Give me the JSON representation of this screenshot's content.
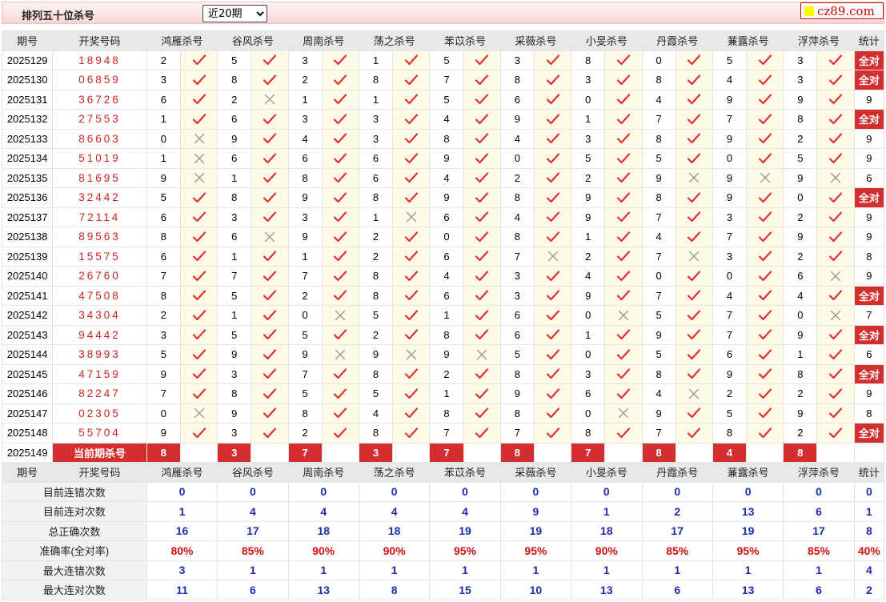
{
  "header": {
    "title": "排列五十位杀号",
    "period_select": {
      "selected": "近20期",
      "options": [
        "近20期"
      ]
    },
    "logo_text": "cz89.com"
  },
  "columns": {
    "issue": "期号",
    "draw": "开奖号码",
    "experts": [
      "鸿雁杀号",
      "谷风杀号",
      "周南杀号",
      "荡之杀号",
      "苯苡杀号",
      "采薇杀号",
      "小旻杀号",
      "丹霞杀号",
      "蒹露杀号",
      "浮萍杀号"
    ],
    "stat": "统计"
  },
  "rows": [
    {
      "issue": "2025129",
      "draw": "18948",
      "kills": [
        "2",
        "5",
        "3",
        "1",
        "5",
        "3",
        "8",
        "0",
        "5",
        "3"
      ],
      "marks": [
        "r",
        "r",
        "r",
        "r",
        "r",
        "r",
        "r",
        "r",
        "r",
        "r"
      ],
      "stat": "全对"
    },
    {
      "issue": "2025130",
      "draw": "06859",
      "kills": [
        "3",
        "8",
        "2",
        "8",
        "7",
        "8",
        "3",
        "8",
        "4",
        "3"
      ],
      "marks": [
        "r",
        "r",
        "r",
        "r",
        "r",
        "r",
        "r",
        "r",
        "r",
        "r"
      ],
      "stat": "全对"
    },
    {
      "issue": "2025131",
      "draw": "36726",
      "kills": [
        "6",
        "2",
        "1",
        "1",
        "5",
        "6",
        "0",
        "4",
        "9",
        "9"
      ],
      "marks": [
        "r",
        "w",
        "r",
        "r",
        "r",
        "r",
        "r",
        "r",
        "r",
        "r"
      ],
      "stat": "9"
    },
    {
      "issue": "2025132",
      "draw": "27553",
      "kills": [
        "1",
        "6",
        "3",
        "3",
        "4",
        "9",
        "1",
        "7",
        "7",
        "8"
      ],
      "marks": [
        "r",
        "r",
        "r",
        "r",
        "r",
        "r",
        "r",
        "r",
        "r",
        "r"
      ],
      "stat": "全对"
    },
    {
      "issue": "2025133",
      "draw": "86603",
      "kills": [
        "0",
        "9",
        "4",
        "3",
        "8",
        "4",
        "3",
        "8",
        "9",
        "2"
      ],
      "marks": [
        "w",
        "r",
        "r",
        "r",
        "r",
        "r",
        "r",
        "r",
        "r",
        "r"
      ],
      "stat": "9"
    },
    {
      "issue": "2025134",
      "draw": "51019",
      "kills": [
        "1",
        "6",
        "6",
        "6",
        "9",
        "0",
        "5",
        "5",
        "0",
        "5"
      ],
      "marks": [
        "w",
        "r",
        "r",
        "r",
        "r",
        "r",
        "r",
        "r",
        "r",
        "r"
      ],
      "stat": "9"
    },
    {
      "issue": "2025135",
      "draw": "81695",
      "kills": [
        "9",
        "1",
        "8",
        "6",
        "4",
        "2",
        "2",
        "9",
        "9",
        "9"
      ],
      "marks": [
        "w",
        "r",
        "r",
        "r",
        "r",
        "r",
        "r",
        "w",
        "w",
        "w"
      ],
      "stat": "6"
    },
    {
      "issue": "2025136",
      "draw": "32442",
      "kills": [
        "5",
        "8",
        "9",
        "8",
        "9",
        "8",
        "9",
        "8",
        "9",
        "0"
      ],
      "marks": [
        "r",
        "r",
        "r",
        "r",
        "r",
        "r",
        "r",
        "r",
        "r",
        "r"
      ],
      "stat": "全对"
    },
    {
      "issue": "2025137",
      "draw": "72114",
      "kills": [
        "6",
        "3",
        "3",
        "1",
        "6",
        "4",
        "9",
        "7",
        "3",
        "2"
      ],
      "marks": [
        "r",
        "r",
        "r",
        "w",
        "r",
        "r",
        "r",
        "r",
        "r",
        "r"
      ],
      "stat": "9"
    },
    {
      "issue": "2025138",
      "draw": "89563",
      "kills": [
        "8",
        "6",
        "9",
        "2",
        "0",
        "8",
        "1",
        "4",
        "7",
        "9"
      ],
      "marks": [
        "r",
        "w",
        "r",
        "r",
        "r",
        "r",
        "r",
        "r",
        "r",
        "r"
      ],
      "stat": "9"
    },
    {
      "issue": "2025139",
      "draw": "15575",
      "kills": [
        "6",
        "1",
        "1",
        "2",
        "6",
        "7",
        "2",
        "7",
        "3",
        "2"
      ],
      "marks": [
        "r",
        "r",
        "r",
        "r",
        "r",
        "w",
        "r",
        "w",
        "r",
        "r"
      ],
      "stat": "8"
    },
    {
      "issue": "2025140",
      "draw": "26760",
      "kills": [
        "7",
        "7",
        "7",
        "8",
        "4",
        "3",
        "4",
        "0",
        "0",
        "6"
      ],
      "marks": [
        "r",
        "r",
        "r",
        "r",
        "r",
        "r",
        "r",
        "r",
        "r",
        "w"
      ],
      "stat": "9"
    },
    {
      "issue": "2025141",
      "draw": "47508",
      "kills": [
        "8",
        "5",
        "2",
        "8",
        "6",
        "3",
        "9",
        "7",
        "4",
        "4"
      ],
      "marks": [
        "r",
        "r",
        "r",
        "r",
        "r",
        "r",
        "r",
        "r",
        "r",
        "r"
      ],
      "stat": "全对"
    },
    {
      "issue": "2025142",
      "draw": "34304",
      "kills": [
        "2",
        "1",
        "0",
        "5",
        "1",
        "6",
        "0",
        "5",
        "7",
        "0"
      ],
      "marks": [
        "r",
        "r",
        "w",
        "r",
        "r",
        "r",
        "w",
        "r",
        "r",
        "w"
      ],
      "stat": "7"
    },
    {
      "issue": "2025143",
      "draw": "94442",
      "kills": [
        "3",
        "5",
        "5",
        "2",
        "8",
        "6",
        "1",
        "9",
        "7",
        "9"
      ],
      "marks": [
        "r",
        "r",
        "r",
        "r",
        "r",
        "r",
        "r",
        "r",
        "r",
        "r"
      ],
      "stat": "全对"
    },
    {
      "issue": "2025144",
      "draw": "38993",
      "kills": [
        "5",
        "9",
        "9",
        "9",
        "9",
        "5",
        "0",
        "5",
        "6",
        "1"
      ],
      "marks": [
        "r",
        "r",
        "w",
        "w",
        "w",
        "r",
        "r",
        "r",
        "r",
        "r"
      ],
      "stat": "6"
    },
    {
      "issue": "2025145",
      "draw": "47159",
      "kills": [
        "9",
        "3",
        "7",
        "8",
        "2",
        "8",
        "3",
        "8",
        "9",
        "8"
      ],
      "marks": [
        "r",
        "r",
        "r",
        "r",
        "r",
        "r",
        "r",
        "r",
        "r",
        "r"
      ],
      "stat": "全对"
    },
    {
      "issue": "2025146",
      "draw": "82247",
      "kills": [
        "7",
        "8",
        "5",
        "5",
        "1",
        "9",
        "6",
        "4",
        "2",
        "2"
      ],
      "marks": [
        "r",
        "r",
        "r",
        "r",
        "r",
        "r",
        "r",
        "w",
        "r",
        "r"
      ],
      "stat": "9"
    },
    {
      "issue": "2025147",
      "draw": "02305",
      "kills": [
        "0",
        "9",
        "8",
        "4",
        "8",
        "8",
        "0",
        "9",
        "5",
        "9"
      ],
      "marks": [
        "w",
        "r",
        "r",
        "r",
        "r",
        "r",
        "w",
        "r",
        "r",
        "r"
      ],
      "stat": "8"
    },
    {
      "issue": "2025148",
      "draw": "55704",
      "kills": [
        "9",
        "3",
        "2",
        "8",
        "7",
        "7",
        "8",
        "7",
        "8",
        "2"
      ],
      "marks": [
        "r",
        "r",
        "r",
        "r",
        "r",
        "r",
        "r",
        "r",
        "r",
        "r"
      ],
      "stat": "全对"
    }
  ],
  "current": {
    "issue": "2025149",
    "label": "当前期杀号",
    "kills": [
      "8",
      "3",
      "7",
      "3",
      "7",
      "8",
      "7",
      "8",
      "4",
      "8"
    ]
  },
  "summary": [
    {
      "label": "目前连错次数",
      "values": [
        "0",
        "0",
        "0",
        "0",
        "0",
        "0",
        "0",
        "0",
        "0",
        "0"
      ],
      "stat": "0",
      "red": false
    },
    {
      "label": "目前连对次数",
      "values": [
        "1",
        "4",
        "4",
        "4",
        "4",
        "9",
        "1",
        "2",
        "13",
        "6"
      ],
      "stat": "1",
      "red": false
    },
    {
      "label": "总正确次数",
      "values": [
        "16",
        "17",
        "18",
        "18",
        "19",
        "19",
        "18",
        "17",
        "19",
        "17"
      ],
      "stat": "8",
      "red": false
    },
    {
      "label": "准确率(全对率)",
      "values": [
        "80%",
        "85%",
        "90%",
        "90%",
        "95%",
        "95%",
        "90%",
        "85%",
        "95%",
        "85%"
      ],
      "stat": "40%",
      "red": true
    },
    {
      "label": "最大连错次数",
      "values": [
        "3",
        "1",
        "1",
        "1",
        "1",
        "1",
        "1",
        "1",
        "1",
        "1"
      ],
      "stat": "4",
      "red": false
    },
    {
      "label": "最大连对次数",
      "values": [
        "11",
        "6",
        "13",
        "8",
        "15",
        "10",
        "13",
        "6",
        "13",
        "6"
      ],
      "stat": "2",
      "red": false
    }
  ],
  "colors": {
    "accent_red": "#d32f2f",
    "check_red": "#e03030",
    "cross_gray": "#9a9a9a",
    "summary_blue": "#1c2ea8",
    "mark_bg": "#fdfbe8"
  },
  "icons": {
    "right": "check-icon",
    "wrong": "cross-icon"
  }
}
